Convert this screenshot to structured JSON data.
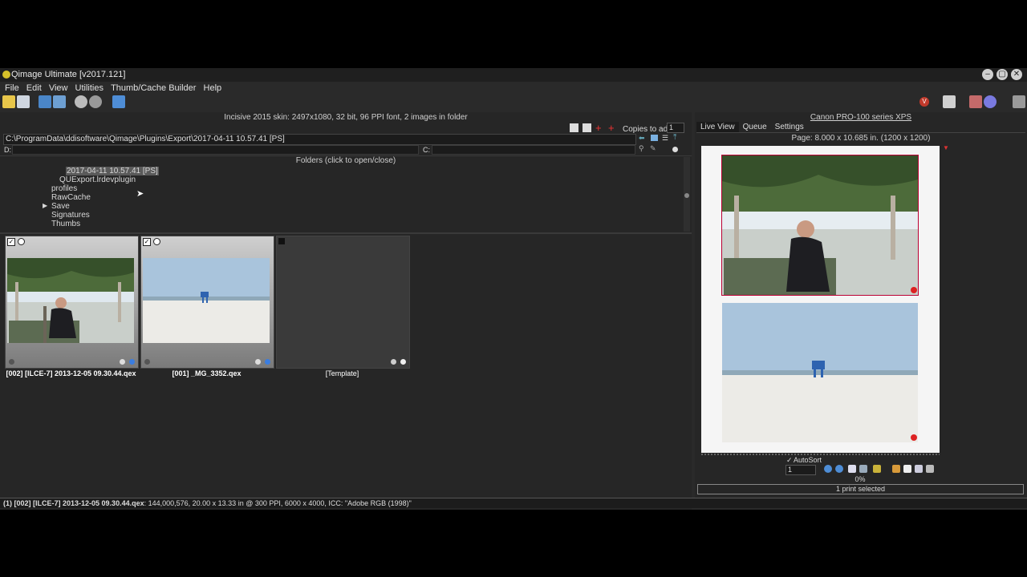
{
  "window": {
    "title": "Qimage Ultimate [v2017.121]"
  },
  "menu": [
    "File",
    "Edit",
    "View",
    "Utilities",
    "Thumb/Cache Builder",
    "Help"
  ],
  "left_panel": {
    "info": "Incisive 2015 skin: 2497x1080, 32 bit, 96 PPI font, 2 images in folder",
    "copies_label": "Copies to add:",
    "copies_value": "1",
    "path": "C:\\ProgramData\\ddisoftware\\Qimage\\Plugins\\Export\\2017-04-11 10.57.41 [PS]",
    "drive_d": "D:",
    "drive_c": "C:",
    "folders_header": "Folders (click to open/close)",
    "tree": [
      "2017-04-11 10.57.41 [PS]",
      "QUExport.lrdevplugin",
      "profiles",
      "RawCache",
      "Save",
      "Signatures",
      "Thumbs"
    ],
    "thumbnails": [
      {
        "label": "[002] [ILCE-7] 2013-12-05 09.30.44.qex"
      },
      {
        "label": "[001] _MG_3352.qex"
      },
      {
        "label": "[Template]"
      }
    ]
  },
  "right_panel": {
    "printer": "Canon PRO-100 series XPS",
    "tabs": [
      "Live View",
      "Queue",
      "Settings"
    ],
    "page_info": "Page: 8.000 x 10.685 in.  (1200 x 1200)",
    "autosort_label": "AutoSort",
    "copies_field": "1",
    "progress_text": "0%",
    "progress_value": 0,
    "selection": "1 print selected"
  },
  "status": {
    "bold": "(1) [002] [ILCE-7] 2013-12-05 09.30.44.qex",
    "rest": ": 144,000,576, 20.00 x 13.33 in @ 300 PPI, 6000 x 4000, ICC: \"Adobe RGB (1998)\""
  }
}
